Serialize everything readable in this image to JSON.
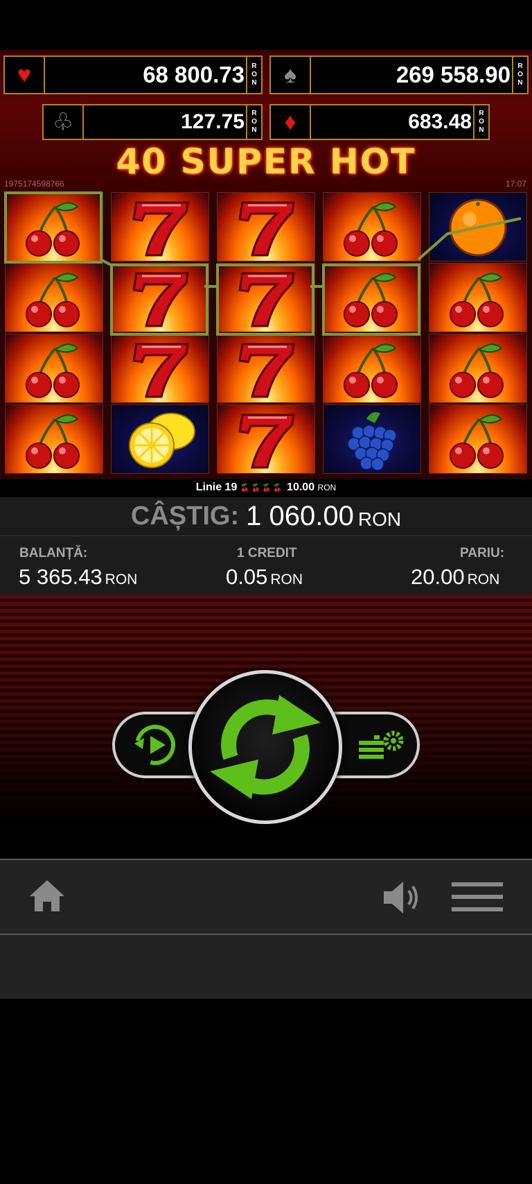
{
  "jackpots": {
    "hearts": {
      "symbol": "♥",
      "value": "68 800.73",
      "currency_letters": [
        "R",
        "O",
        "N"
      ]
    },
    "spades": {
      "symbol": "♠",
      "value": "269 558.90",
      "currency_letters": [
        "R",
        "O",
        "N"
      ]
    },
    "clubs": {
      "symbol": "♧",
      "value": "127.75",
      "currency_letters": [
        "R",
        "O",
        "N"
      ]
    },
    "diamonds": {
      "symbol": "♦",
      "value": "683.48",
      "currency_letters": [
        "R",
        "O",
        "N"
      ]
    }
  },
  "game": {
    "title": "40 SUPER HOT",
    "id": "1975174598766",
    "time": "17:07"
  },
  "reels": [
    [
      "cherry",
      "cherry",
      "cherry",
      "cherry"
    ],
    [
      "seven",
      "seven",
      "seven",
      "lemon"
    ],
    [
      "seven",
      "seven",
      "seven",
      "seven"
    ],
    [
      "cherry",
      "cherry",
      "cherry",
      "grapes"
    ],
    [
      "orange",
      "cherry",
      "cherry",
      "cherry"
    ]
  ],
  "win_line": {
    "label": "Linie 19",
    "icons": "🍒🍒🍒🍒",
    "amount": "10.00",
    "currency": "RON"
  },
  "win": {
    "label": "CÂȘTIG:",
    "amount": "1 060.00",
    "currency": "RON"
  },
  "info": {
    "balance": {
      "label": "BALANȚĂ:",
      "value": "5 365.43",
      "currency": "RON"
    },
    "credit": {
      "label": "1 CREDIT",
      "value": "0.05",
      "currency": "RON"
    },
    "bet": {
      "label": "PARIU:",
      "value": "20.00",
      "currency": "RON"
    }
  },
  "controls": {
    "autoplay_icon": "autoplay-icon",
    "spin_icon": "spin-icon",
    "settings_icon": "bet-settings-icon"
  },
  "nav": {
    "home_icon": "home-icon",
    "sound_icon": "speaker-icon",
    "menu_icon": "hamburger-menu-icon"
  },
  "colors": {
    "frame_gold": "#b8860b",
    "win_green": "#7c9a3a",
    "spin_green": "#5fbf1a"
  }
}
